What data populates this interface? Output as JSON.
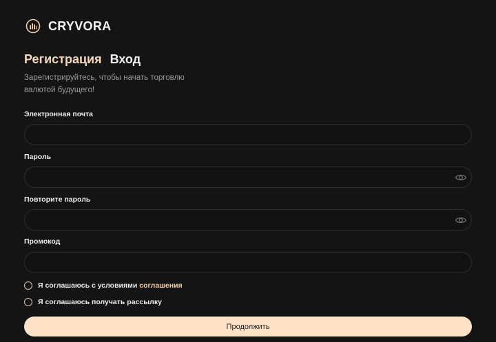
{
  "brand": {
    "name": "CRYVORA",
    "logo_icon": "bar-chart-circle-icon"
  },
  "auth_tabs": {
    "register_label": "Регистрация",
    "login_label": "Вход",
    "active": "register"
  },
  "subtitle": "Зарегистрируйтесь, чтобы начать торговлю валютой будущего!",
  "form": {
    "email": {
      "label": "Электронная почта",
      "value": "",
      "placeholder": ""
    },
    "password": {
      "label": "Пароль",
      "value": "",
      "placeholder": "",
      "toggle_icon": "eye-icon"
    },
    "password_repeat": {
      "label": "Повторите пароль",
      "value": "",
      "placeholder": "",
      "toggle_icon": "eye-icon"
    },
    "promo": {
      "label": "Промокод",
      "value": "",
      "placeholder": ""
    }
  },
  "agreements": {
    "terms_text": "Я соглашаюсь с условиями",
    "terms_link": "соглашения",
    "newsletter_text": "Я соглашаюсь получать рассылку"
  },
  "submit_label": "Продолжить",
  "colors": {
    "background": "#141414",
    "accent": "#f6d9bd",
    "button_bg": "#fde2c7",
    "muted_text": "#9a9a9a",
    "input_border": "#2e2e2e"
  }
}
